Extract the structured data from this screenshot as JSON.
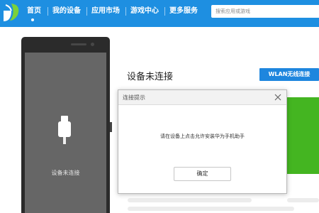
{
  "colors": {
    "topbar": "#1e8fe1",
    "accent_button": "#1e86de",
    "phone_body": "#2b2b2b",
    "phone_screen": "#666666",
    "green_card": "#44b521"
  },
  "header": {
    "logo_icon": "app-logo-icon",
    "nav": [
      {
        "label": "首页",
        "active": true
      },
      {
        "label": "我的设备",
        "active": false
      },
      {
        "label": "应用市场",
        "active": false
      },
      {
        "label": "游戏中心",
        "active": false
      },
      {
        "label": "更多服务",
        "active": false
      }
    ],
    "search_placeholder": "搜索应用或游戏"
  },
  "device": {
    "status_label": "设备未连接",
    "usb_icon": "usb-plug-icon"
  },
  "main": {
    "title": "设备未连接",
    "wlan_button": "WLAN无线连接"
  },
  "dialog": {
    "title": "连接提示",
    "close_icon": "close-icon",
    "message": "请在设备上点击允许安装华为手机助手",
    "ok_button": "确定"
  }
}
